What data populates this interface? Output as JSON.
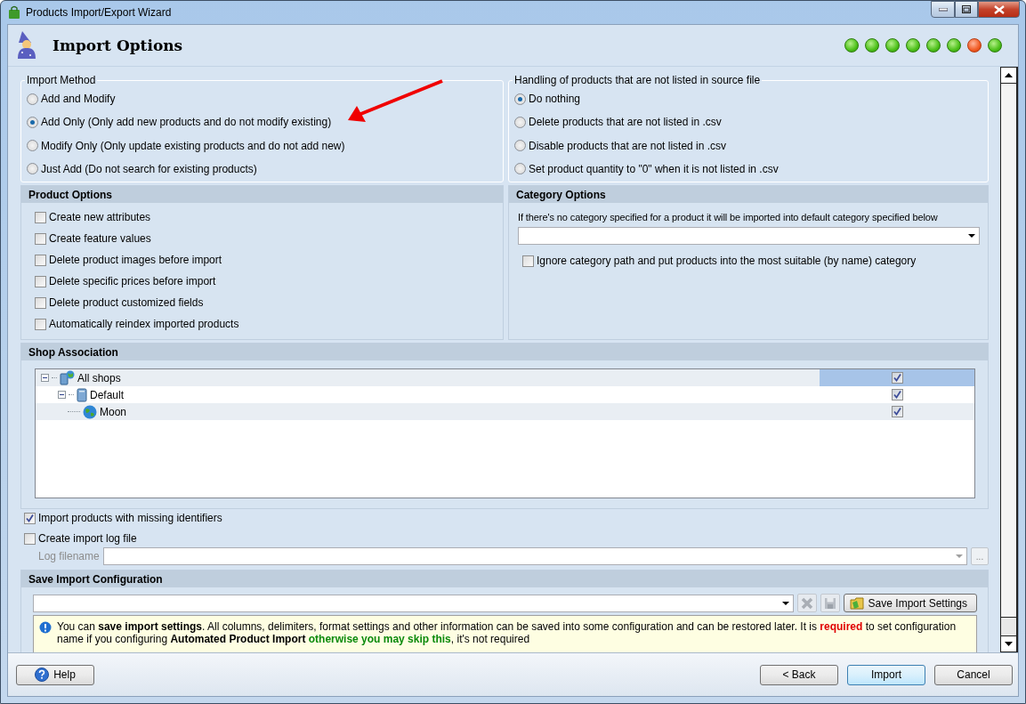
{
  "window": {
    "title": "Products Import/Export Wizard"
  },
  "header": {
    "title": "Import Options",
    "steps": [
      {
        "current": false
      },
      {
        "current": false
      },
      {
        "current": false
      },
      {
        "current": false
      },
      {
        "current": false
      },
      {
        "current": false
      },
      {
        "current": true
      },
      {
        "current": false
      }
    ]
  },
  "import_method": {
    "title": "Import Method",
    "options": [
      {
        "label": "Add and Modify",
        "selected": false
      },
      {
        "label": "Add Only (Only add new products and do not modify existing)",
        "selected": true
      },
      {
        "label": "Modify Only (Only update existing products and do not add new)",
        "selected": false
      },
      {
        "label": "Just Add (Do not search for existing products)",
        "selected": false
      }
    ]
  },
  "unlisted_handling": {
    "title": "Handling of products that are not listed in source file",
    "options": [
      {
        "label": "Do nothing",
        "selected": true
      },
      {
        "label": "Delete products that are not listed in .csv",
        "selected": false
      },
      {
        "label": "Disable products that are not listed in .csv",
        "selected": false
      },
      {
        "label": "Set product quantity to \"0\" when it is not listed in .csv",
        "selected": false
      }
    ]
  },
  "product_options": {
    "title": "Product Options",
    "items": [
      {
        "label": "Create new attributes",
        "checked": false
      },
      {
        "label": "Create feature values",
        "checked": false
      },
      {
        "label": "Delete product images before import",
        "checked": false
      },
      {
        "label": "Delete specific prices before import",
        "checked": false
      },
      {
        "label": "Delete product customized fields",
        "checked": false
      },
      {
        "label": "Automatically reindex imported products",
        "checked": false
      }
    ]
  },
  "category_options": {
    "title": "Category Options",
    "hint": "If there's no category specified for a product it will be imported into default category specified below",
    "ignore_path": {
      "label": "Ignore category path and put products into the most suitable (by name) category",
      "checked": false
    }
  },
  "shop_association": {
    "title": "Shop Association",
    "tree": [
      {
        "label": "All shops",
        "kind": "group",
        "checked": true,
        "selected": true,
        "expanded": true,
        "children": [
          {
            "label": "Default",
            "kind": "shop",
            "checked": true,
            "selected": false,
            "expanded": true,
            "children": [
              {
                "label": "Moon",
                "kind": "store",
                "checked": true,
                "selected": false
              }
            ]
          }
        ]
      }
    ]
  },
  "import_missing": {
    "label": "Import products with missing identifiers",
    "checked": true
  },
  "create_log": {
    "label": "Create import log file",
    "checked": false
  },
  "log_filename": {
    "label": "Log filename",
    "disabled": true,
    "browse": "..."
  },
  "save_config": {
    "title": "Save Import Configuration",
    "save_button": "Save Import Settings",
    "info": [
      {
        "text": "You can ",
        "kind": "plain"
      },
      {
        "text": "save import settings",
        "kind": "emphasis"
      },
      {
        "text": ". All columns, delimiters, format settings and other information can be saved into some configuration and can be restored later. It is ",
        "kind": "plain"
      },
      {
        "text": "required",
        "kind": "alert"
      },
      {
        "text": " to set configuration name if you configuring ",
        "kind": "plain"
      },
      {
        "text": "Automated Product Import",
        "kind": "emphasis"
      },
      {
        "text": " otherwise you may skip this",
        "kind": "ok"
      },
      {
        "text": ", it's not required",
        "kind": "plain"
      }
    ]
  },
  "buttons": [
    {
      "label": "Help",
      "kind": "help"
    },
    {
      "label": "< Back",
      "kind": "back"
    },
    {
      "label": "Import",
      "kind": "primary"
    },
    {
      "label": "Cancel",
      "kind": "cancel"
    }
  ]
}
